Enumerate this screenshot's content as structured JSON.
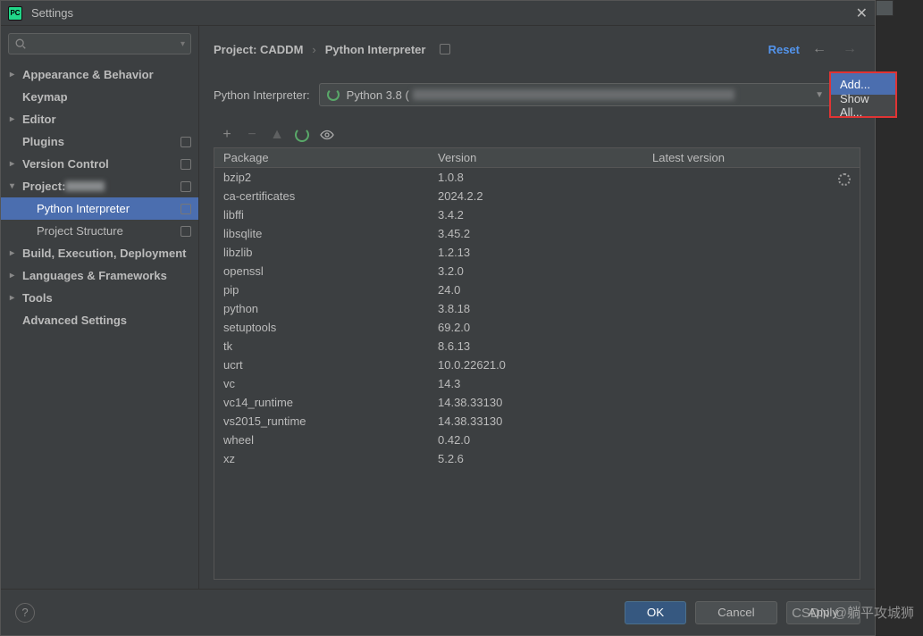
{
  "window": {
    "title": "Settings"
  },
  "sidebar": {
    "search_placeholder": "",
    "items": [
      {
        "label": "Appearance & Behavior",
        "bold": true,
        "chev": true
      },
      {
        "label": "Keymap",
        "bold": true
      },
      {
        "label": "Editor",
        "bold": true,
        "chev": true
      },
      {
        "label": "Plugins",
        "bold": true,
        "badge": true
      },
      {
        "label": "Version Control",
        "bold": true,
        "chev": true,
        "badge": true
      },
      {
        "label": "Project:",
        "bold": true,
        "chev": true,
        "expanded": true,
        "badge": true,
        "blurred": true
      },
      {
        "label": "Python Interpreter",
        "child": true,
        "selected": true,
        "badge": true
      },
      {
        "label": "Project Structure",
        "child": true,
        "badge": true
      },
      {
        "label": "Build, Execution, Deployment",
        "bold": true,
        "chev": true
      },
      {
        "label": "Languages & Frameworks",
        "bold": true,
        "chev": true
      },
      {
        "label": "Tools",
        "bold": true,
        "chev": true
      },
      {
        "label": "Advanced Settings",
        "bold": true
      }
    ]
  },
  "breadcrumb": {
    "seg1": "Project: CADDM",
    "seg2": "Python Interpreter",
    "reset": "Reset"
  },
  "interpreter": {
    "label": "Python Interpreter:",
    "value": "Python 3.8 ("
  },
  "dropdown": {
    "add": "Add...",
    "showall": "Show All..."
  },
  "table": {
    "headers": {
      "package": "Package",
      "version": "Version",
      "latest": "Latest version"
    },
    "rows": [
      {
        "name": "bzip2",
        "version": "1.0.8"
      },
      {
        "name": "ca-certificates",
        "version": "2024.2.2"
      },
      {
        "name": "libffi",
        "version": "3.4.2"
      },
      {
        "name": "libsqlite",
        "version": "3.45.2"
      },
      {
        "name": "libzlib",
        "version": "1.2.13"
      },
      {
        "name": "openssl",
        "version": "3.2.0"
      },
      {
        "name": "pip",
        "version": "24.0"
      },
      {
        "name": "python",
        "version": "3.8.18"
      },
      {
        "name": "setuptools",
        "version": "69.2.0"
      },
      {
        "name": "tk",
        "version": "8.6.13"
      },
      {
        "name": "ucrt",
        "version": "10.0.22621.0"
      },
      {
        "name": "vc",
        "version": "14.3"
      },
      {
        "name": "vc14_runtime",
        "version": "14.38.33130"
      },
      {
        "name": "vs2015_runtime",
        "version": "14.38.33130"
      },
      {
        "name": "wheel",
        "version": "0.42.0"
      },
      {
        "name": "xz",
        "version": "5.2.6"
      }
    ]
  },
  "footer": {
    "ok": "OK",
    "cancel": "Cancel",
    "apply": "Apply"
  },
  "watermark": "CSDN @躺平攻城狮"
}
